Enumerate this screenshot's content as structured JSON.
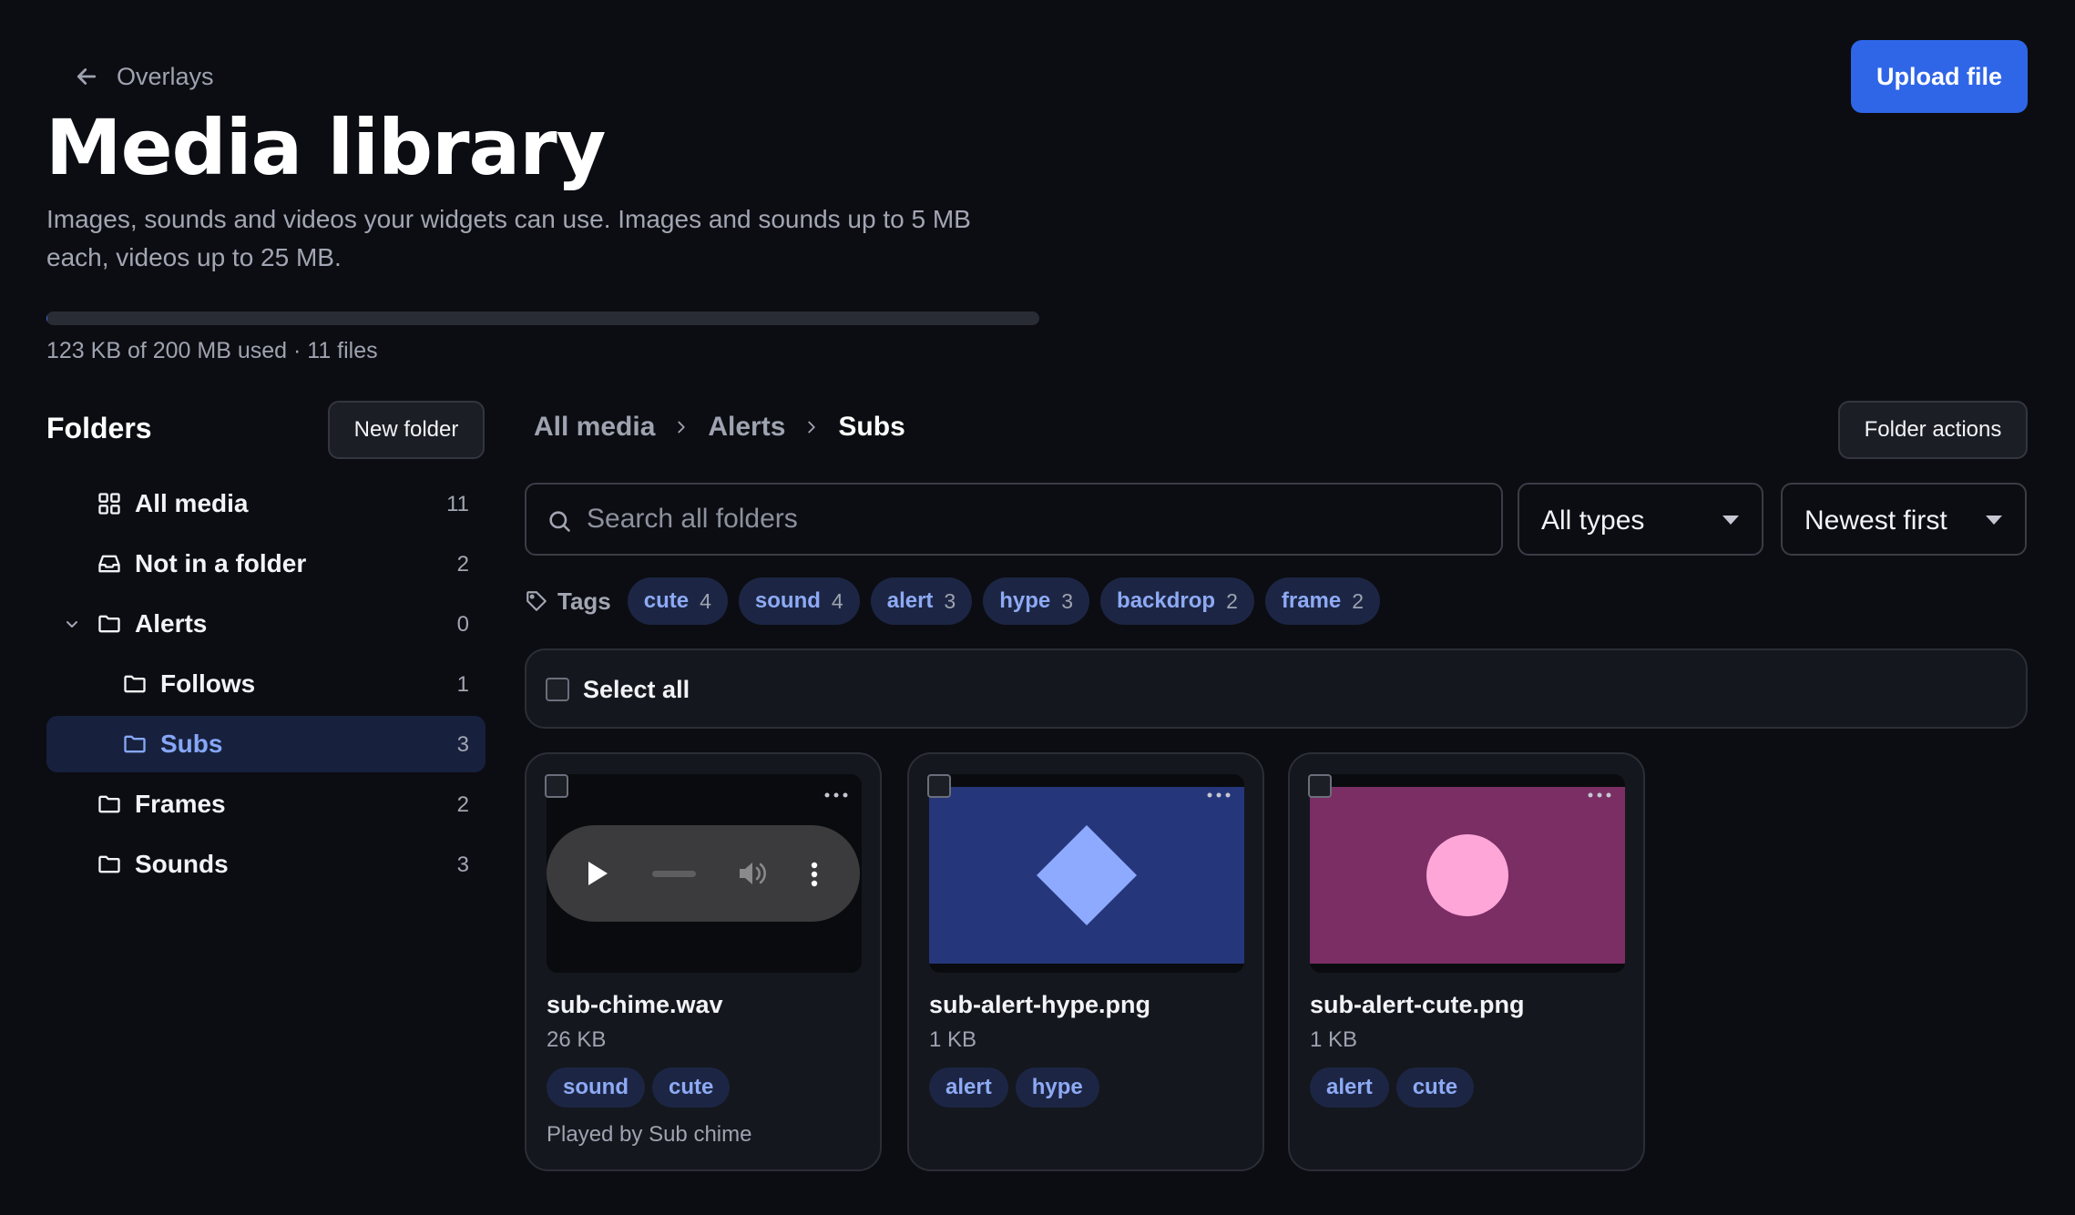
{
  "header": {
    "back_label": "Overlays",
    "title": "Media library",
    "description": "Images, sounds and videos your widgets can use. Images and sounds up to 5 MB each, videos up to 25 MB.",
    "storage_text": "123 KB of 200 MB used · 11 files",
    "storage_used_fraction": 0.0006,
    "upload_label": "Upload file"
  },
  "sidebar": {
    "heading": "Folders",
    "new_folder_label": "New folder",
    "items": [
      {
        "label": "All media",
        "count": "11",
        "icon": "grid-icon"
      },
      {
        "label": "Not in a folder",
        "count": "2",
        "icon": "inbox-icon"
      },
      {
        "label": "Alerts",
        "count": "0",
        "icon": "folder-icon",
        "expanded": true
      },
      {
        "label": "Follows",
        "count": "1",
        "icon": "folder-icon"
      },
      {
        "label": "Subs",
        "count": "3",
        "icon": "folder-icon",
        "active": true
      },
      {
        "label": "Frames",
        "count": "2",
        "icon": "folder-icon"
      },
      {
        "label": "Sounds",
        "count": "3",
        "icon": "folder-icon"
      }
    ]
  },
  "main": {
    "breadcrumb": [
      "All media",
      "Alerts",
      "Subs"
    ],
    "folder_actions_label": "Folder actions",
    "search_placeholder": "Search all folders",
    "type_filter": "All types",
    "sort": "Newest first",
    "tags_label": "Tags",
    "tags": [
      {
        "name": "cute",
        "count": "4"
      },
      {
        "name": "sound",
        "count": "4"
      },
      {
        "name": "alert",
        "count": "3"
      },
      {
        "name": "hype",
        "count": "3"
      },
      {
        "name": "backdrop",
        "count": "2"
      },
      {
        "name": "frame",
        "count": "2"
      }
    ],
    "select_all_label": "Select all",
    "files": [
      {
        "name": "sub-chime.wav",
        "size": "26 KB",
        "tags": [
          "sound",
          "cute"
        ],
        "note": "Played by Sub chime",
        "preview": "audio-player"
      },
      {
        "name": "sub-alert-hype.png",
        "size": "1 KB",
        "tags": [
          "alert",
          "hype"
        ],
        "preview": "diamond",
        "bg_color": "#26367a",
        "shape_color": "#8eaaff"
      },
      {
        "name": "sub-alert-cute.png",
        "size": "1 KB",
        "tags": [
          "alert",
          "cute"
        ],
        "preview": "circle",
        "bg_color": "#7a2e64",
        "shape_color": "#ffa6d9"
      }
    ]
  },
  "colors": {
    "background": "#0c0d12",
    "accent": "#2f66e8",
    "active_folder_bg": "#17213d",
    "tag_bg": "#1c2644",
    "tag_text": "#8eaaf5"
  }
}
